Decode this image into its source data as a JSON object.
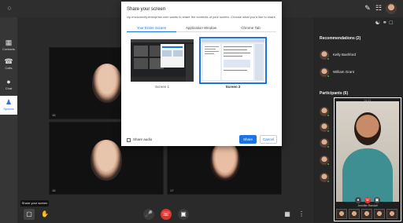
{
  "rail": {
    "items": [
      {
        "label": "Contacts",
        "icon": "contacts-icon"
      },
      {
        "label": "Calls",
        "icon": "phone-icon"
      },
      {
        "label": "Chat",
        "icon": "chat-icon"
      },
      {
        "label": "Spaces",
        "icon": "people-icon"
      }
    ]
  },
  "tiles": [
    {
      "num": "15"
    },
    {
      "num": "16"
    },
    {
      "num": "17"
    },
    {
      "num": "18"
    }
  ],
  "bottombar": {
    "tooltip": "Share your screen"
  },
  "dialog": {
    "title": "Share your screen",
    "subtitle": "vip.enctconcity.enterprise.com wants to share the contents of your screen. Choose what you'd like to share.",
    "tabs": [
      "Your Entire Screen",
      "Application Window",
      "Chrome Tab"
    ],
    "screens": [
      "Screen 1",
      "Screen 2"
    ],
    "share_audio": "Share audio",
    "share_label": "Share",
    "cancel_label": "Cancel"
  },
  "panel": {
    "recommendations_header": "Recommendations (2)",
    "recommendations": [
      "Kelly Bashford",
      "William Grant"
    ],
    "participants_header": "Participants (6)"
  },
  "preview": {
    "time": "01:21",
    "caption": "Jennifer Randall"
  },
  "colors": {
    "accent": "#1a73e8",
    "end_call": "#e0332f",
    "presence": "#3cb44b"
  }
}
